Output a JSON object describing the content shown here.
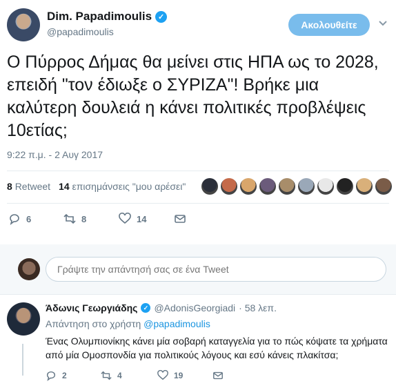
{
  "tweet": {
    "author_name": "Dim. Papadimoulis",
    "author_handle": "@papadimoulis",
    "follow_label": "Ακολουθείτε",
    "text": "Ο Πύρρος Δήμας θα μείνει στις ΗΠΑ ως το 2028, επειδή \"τον έδιωξε ο ΣΥΡΙΖΑ\"! Βρήκε μια καλύτερη δουλειά η κάνει πολιτικές προβλέψεις 10ετίας;",
    "timestamp": "9:22 π.μ. - 2 Αυγ 2017",
    "retweets_count": "8",
    "retweets_label": "Retweet",
    "likes_count": "14",
    "likes_label": "επισημάνσεις \"μου αρέσει\"",
    "actions": {
      "replies": "6",
      "retweets": "8",
      "likes": "14"
    },
    "liker_colors": [
      "#2b2f3a",
      "#c46a4a",
      "#d9a66b",
      "#6b5b7b",
      "#a88d6a",
      "#9aa8b8",
      "#e8e8e8",
      "#222222",
      "#d9b07a",
      "#7a5c48"
    ]
  },
  "reply_box": {
    "placeholder": "Γράψτε την απάντησή σας σε ένα Tweet"
  },
  "reply": {
    "author_name": "Άδωνις Γεωργιάδης",
    "author_handle": "@AdonisGeorgiadi",
    "time": "· 58 λεπ.",
    "replying_prefix": "Απάντηση στο χρήστη",
    "replying_to": "@papadimoulis",
    "text": "Ένας Ολυμπιονίκης κάνει μία σοβαρή καταγγελία για το πώς κόψατε τα χρήματα από μία Ομοσπονδία για πολιτικούς λόγους και εσύ κάνεις πλακίτσα;",
    "actions": {
      "replies": "2",
      "retweets": "4",
      "likes": "19"
    }
  },
  "colors": {
    "accent": "#1da1f2",
    "follow_button": "#79bcec",
    "muted": "#657786"
  }
}
